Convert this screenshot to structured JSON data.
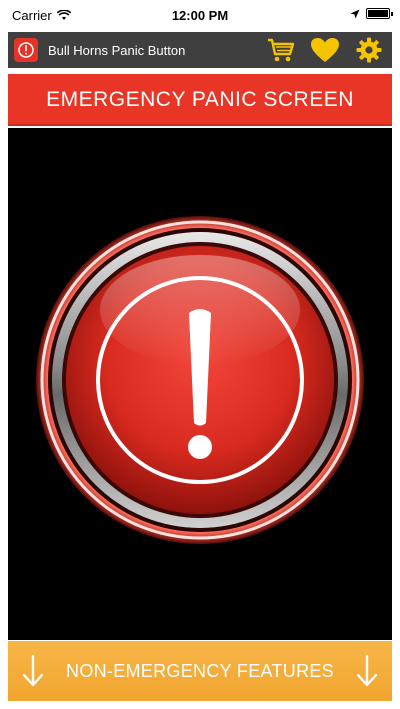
{
  "status_bar": {
    "carrier": "Carrier",
    "time": "12:00 PM"
  },
  "header": {
    "app_title": "Bull Horns Panic Button",
    "icons": [
      "cart-icon",
      "heart-icon",
      "gear-icon"
    ]
  },
  "banner": {
    "title": "EMERGENCY PANIC SCREEN"
  },
  "footer": {
    "label": "NON-EMERGENCY FEATURES"
  },
  "colors": {
    "header_bg": "#3f3f3f",
    "banner_red": "#e83526",
    "accent_yellow": "#f5c400",
    "footer_orange": "#f2a52f",
    "main_bg": "#000000"
  }
}
